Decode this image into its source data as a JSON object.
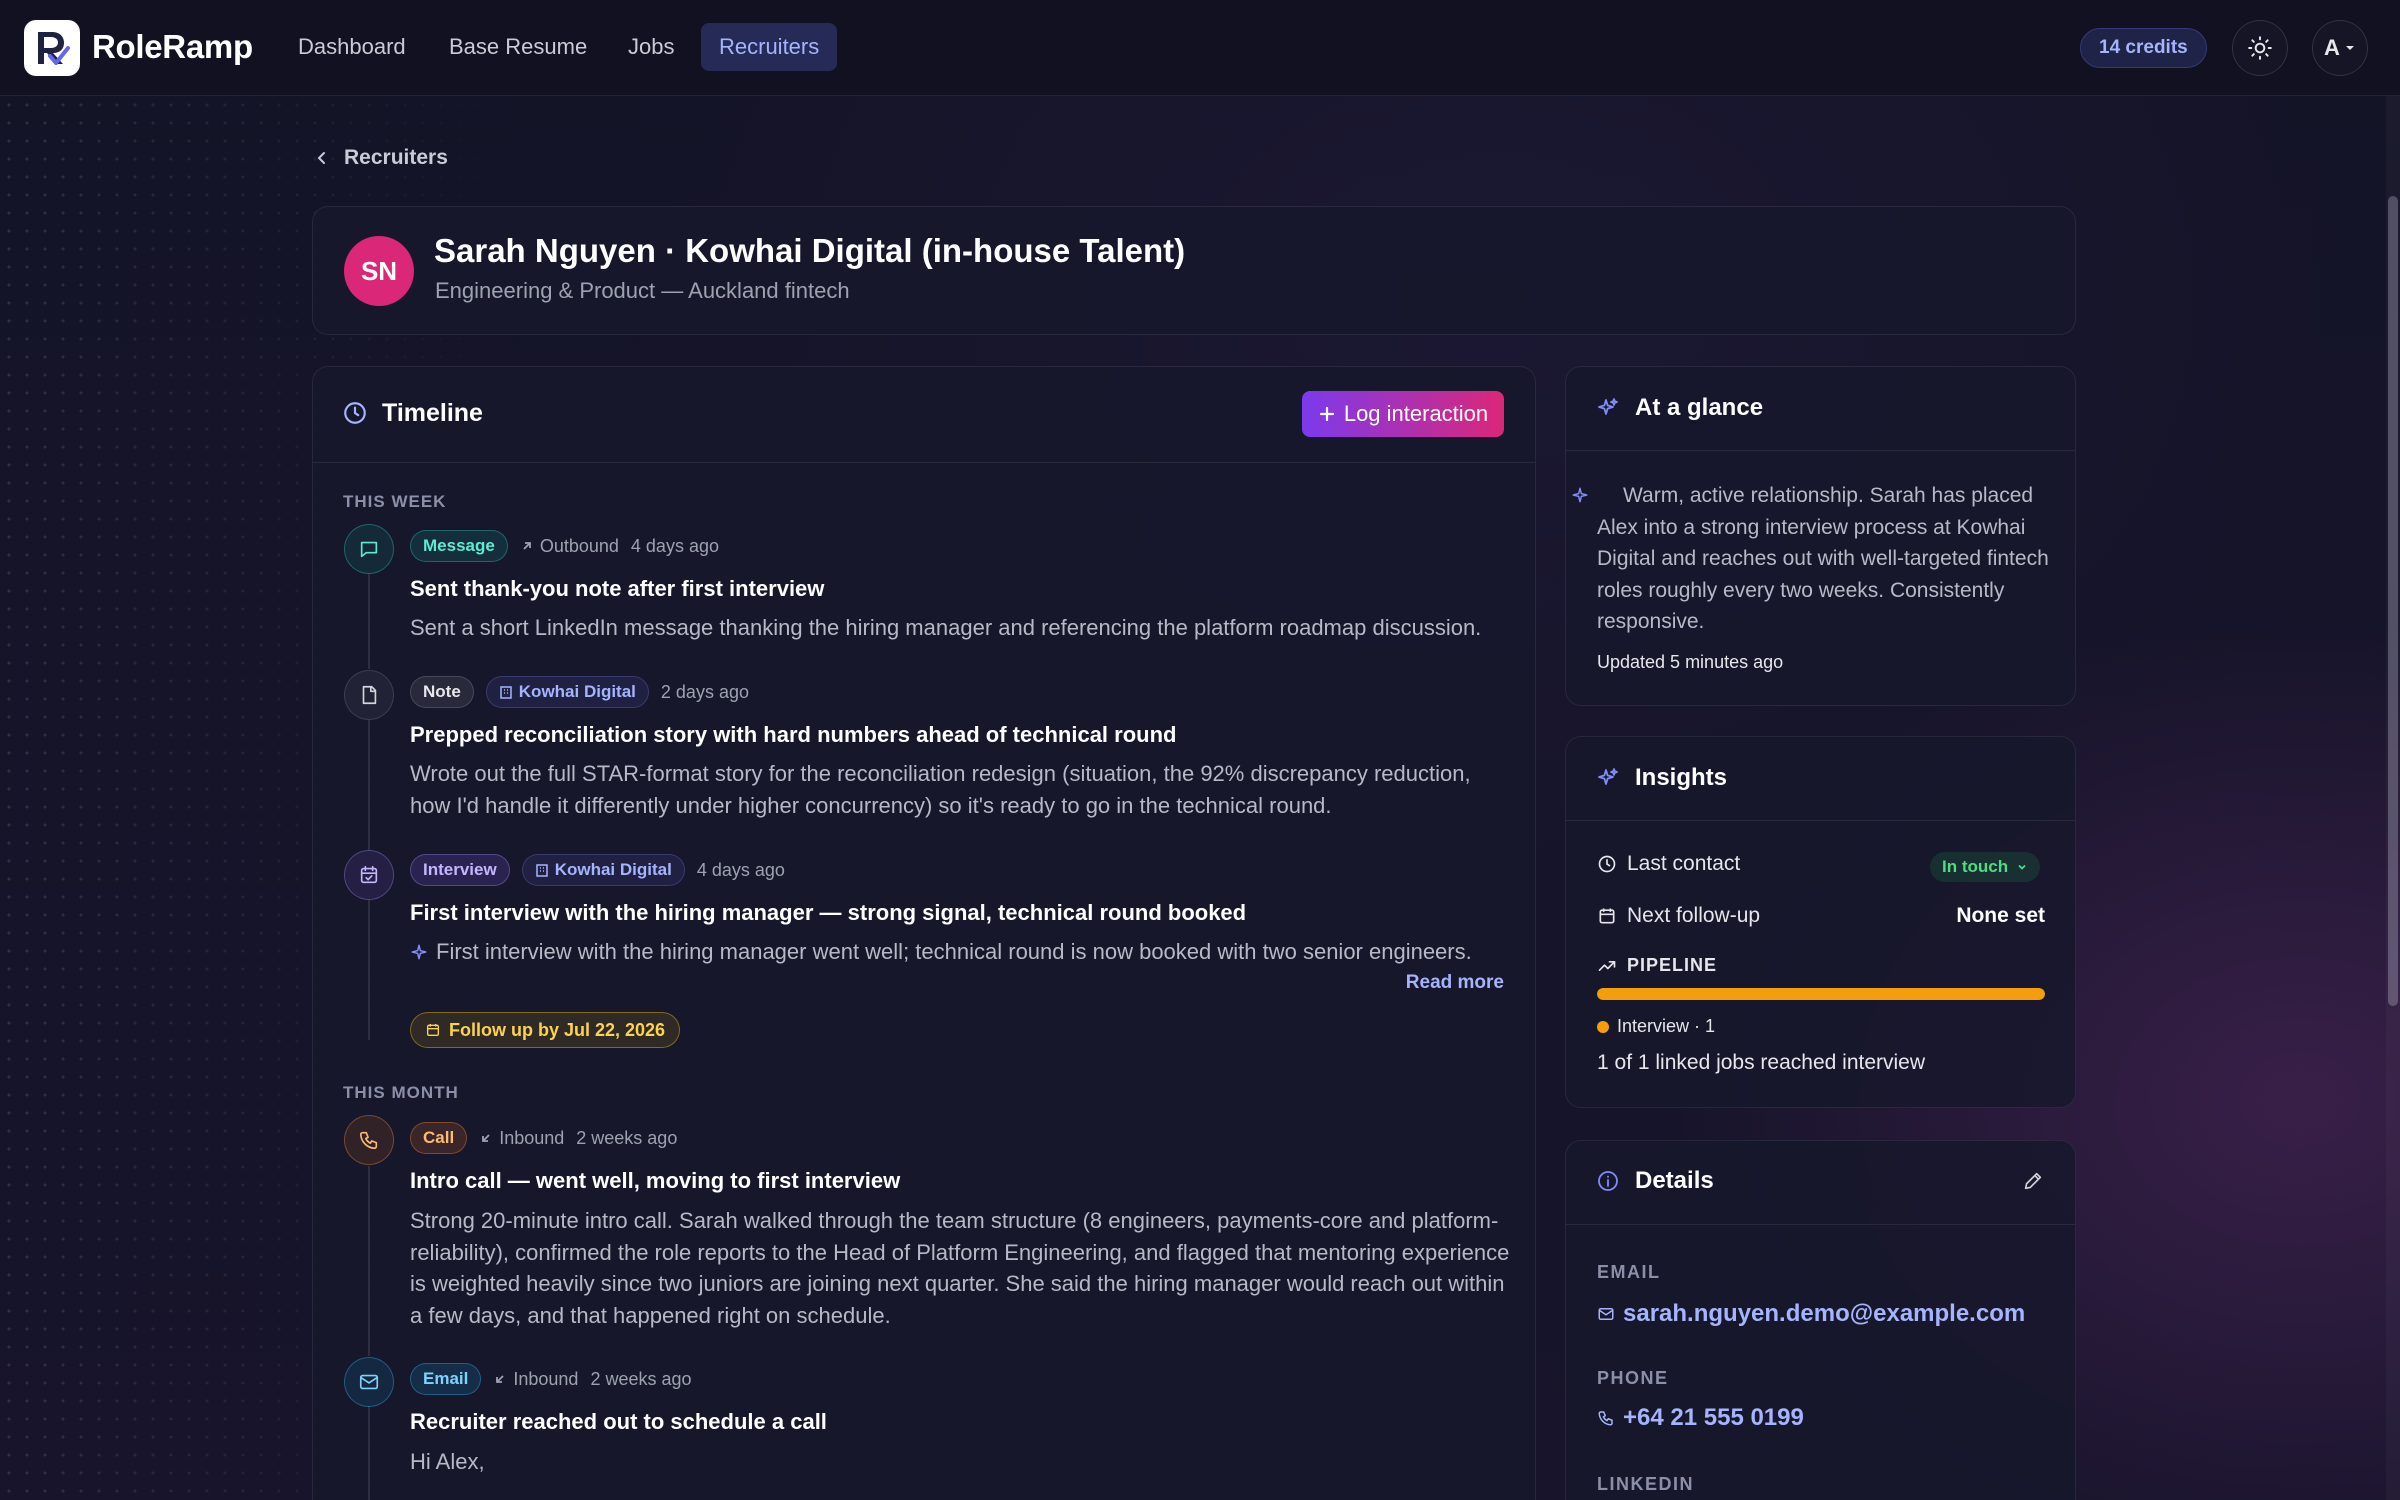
{
  "nav": {
    "brand": "RoleRamp",
    "links": [
      "Dashboard",
      "Base Resume",
      "Jobs",
      "Recruiters"
    ],
    "active": "Recruiters",
    "credits": "14 credits",
    "account_initial": "A"
  },
  "breadcrumb": {
    "back_label": "Recruiters"
  },
  "profile": {
    "initials": "SN",
    "name": "Sarah Nguyen · Kowhai Digital (in-house Talent)",
    "subtitle": "Engineering & Product — Auckland fintech",
    "avatar_color": "#db2777"
  },
  "timeline": {
    "title": "Timeline",
    "log_button": "Log interaction",
    "groups": [
      {
        "label": "THIS WEEK",
        "entries": [
          {
            "type": "Message",
            "direction": "Outbound",
            "time": "4 days ago",
            "title": "Sent thank-you note after first interview",
            "body": "Sent a short LinkedIn message thanking the hiring manager and referencing the platform roadmap discussion."
          },
          {
            "type": "Note",
            "company": "Kowhai Digital",
            "time": "2 days ago",
            "title": "Prepped reconciliation story with hard numbers ahead of technical round",
            "body": "Wrote out the full STAR-format story for the reconciliation redesign (situation, the 92% discrepancy reduction, how I'd handle it differently under higher concurrency) so it's ready to go in the technical round."
          },
          {
            "type": "Interview",
            "company": "Kowhai Digital",
            "time": "4 days ago",
            "title": "First interview with the hiring manager — strong signal, technical round booked",
            "body": "First interview with the hiring manager went well; technical round is now booked with two senior engineers.",
            "read_more": "Read more",
            "follow_up": "Follow up by Jul 22, 2026"
          }
        ]
      },
      {
        "label": "THIS MONTH",
        "entries": [
          {
            "type": "Call",
            "direction": "Inbound",
            "time": "2 weeks ago",
            "title": "Intro call — went well, moving to first interview",
            "body": "Strong 20-minute intro call. Sarah walked through the team structure (8 engineers, payments-core and platform-reliability), confirmed the role reports to the Head of Platform Engineering, and flagged that mentoring experience is weighted heavily since two juniors are joining next quarter. She said the hiring manager would reach out within a few days, and that happened right on schedule."
          },
          {
            "type": "Email",
            "direction": "Inbound",
            "time": "2 weeks ago",
            "title": "Recruiter reached out to schedule a call",
            "body": "Hi Alex,"
          }
        ]
      }
    ]
  },
  "glance": {
    "title": "At a glance",
    "summary": "Warm, active relationship. Sarah has placed Alex into a strong interview process at Kowhai Digital and reaches out with well-targeted fintech roles roughly every two weeks. Consistently responsive.",
    "updated": "Updated 5 minutes ago"
  },
  "insights": {
    "title": "Insights",
    "last_contact_label": "Last contact",
    "last_contact_value": "In touch",
    "next_followup_label": "Next follow-up",
    "next_followup_value": "None set",
    "pipeline_label": "PIPELINE",
    "pipeline_fraction": 1.0,
    "pipeline_color": "#f59e0b",
    "stage_legend": "Interview · 1",
    "pipeline_summary": "1 of 1 linked jobs reached interview"
  },
  "details": {
    "title": "Details",
    "email_label": "EMAIL",
    "email": "sarah.nguyen.demo@example.com",
    "phone_label": "PHONE",
    "phone": "+64 21 555 0199",
    "linkedin_label": "LINKEDIN"
  }
}
